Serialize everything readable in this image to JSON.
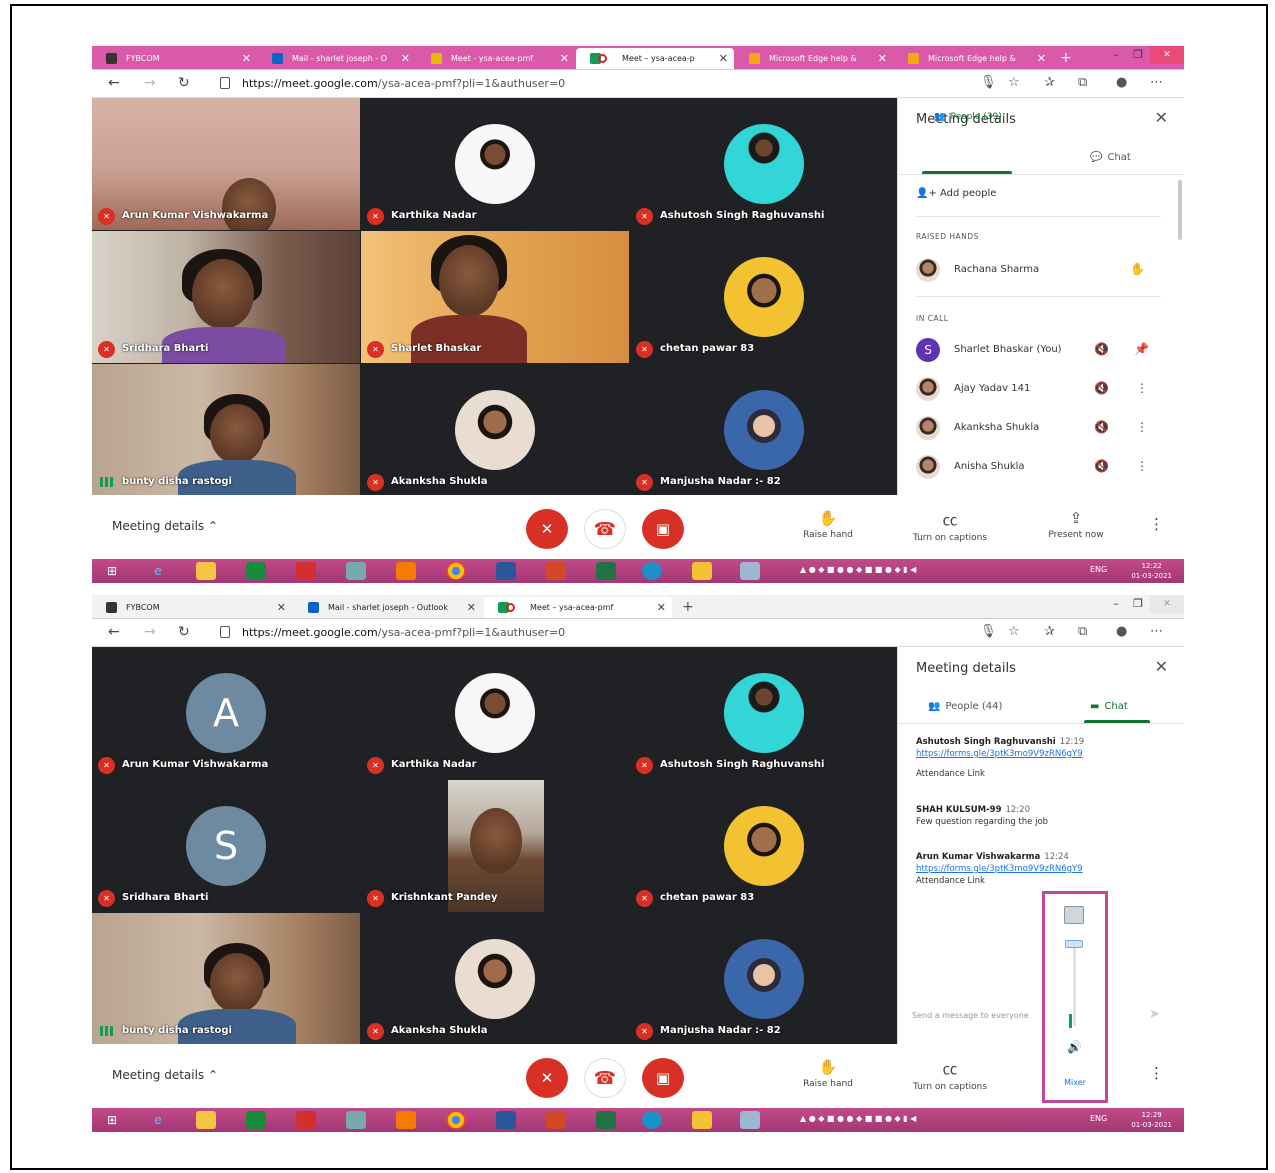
{
  "screens": [
    {
      "tabs": [
        "FYBCOM",
        "Mail - sharlet joseph - O",
        "Meet - ysa-acea-pmf",
        "Meet – ysa-acea-p",
        "Microsoft Edge help & ",
        "Microsoft Edge help & "
      ],
      "url_host": "https://meet.google.com",
      "url_path": "/ysa-acea-pmf?pli=1&authuser=0",
      "tiles": [
        {
          "name": "Arun Kumar Vishwakarma"
        },
        {
          "name": "Karthika Nadar"
        },
        {
          "name": "Ashutosh Singh Raghuvanshi"
        },
        {
          "name": "Sridhara Bharti"
        },
        {
          "name": "Sharlet Bhaskar"
        },
        {
          "name": "chetan pawar 83"
        },
        {
          "name": "bunty disha rastogi"
        },
        {
          "name": "Akanksha Shukla"
        },
        {
          "name": "Manjusha Nadar :- 82"
        }
      ],
      "panel": {
        "title": "Meeting details",
        "tab_people": "People (39)",
        "tab_chat": "Chat",
        "add_people": "Add people",
        "raised_hands": "RAISED HANDS",
        "raised": "Rachana Sharma",
        "in_call": "IN CALL",
        "avatar_letter": "S",
        "people": [
          "Sharlet Bhaskar (You)",
          "Ajay Yadav 141",
          "Akanksha Shukla",
          "Anisha Shukla"
        ]
      },
      "controls": {
        "meeting_details": "Meeting details",
        "raise_hand": "Raise hand",
        "captions": "Turn on captions",
        "present": "Present now"
      },
      "taskbar": {
        "lang": "ENG",
        "time": "12:22",
        "date": "01-03-2021"
      }
    },
    {
      "tabs": [
        "FYBCOM",
        "Mail - sharlet joseph - Outlook",
        "Meet – ysa-acea-pmf"
      ],
      "url_host": "https://meet.google.com",
      "url_path": "/ysa-acea-pmf?pli=1&authuser=0",
      "tiles": [
        {
          "name": "Arun Kumar Vishwakarma",
          "letter": "A"
        },
        {
          "name": "Karthika Nadar"
        },
        {
          "name": "Ashutosh Singh Raghuvanshi"
        },
        {
          "name": "Sridhara Bharti",
          "letter": "S"
        },
        {
          "name": "Krishnkant Pandey"
        },
        {
          "name": "chetan pawar 83"
        },
        {
          "name": "bunty disha rastogi"
        },
        {
          "name": "Akanksha Shukla"
        },
        {
          "name": "Manjusha Nadar :- 82"
        }
      ],
      "panel": {
        "title": "Meeting details",
        "tab_people": "People (44)",
        "tab_chat": "Chat",
        "messages": [
          {
            "author": "Ashutosh Singh Raghuvanshi",
            "time": "12:19",
            "link": "https://forms.gle/3ptK3mo9V9zRN6gY9",
            "text": "Attendance Link"
          },
          {
            "author": "SHAH KULSUM-99",
            "time": "12:20",
            "text": "Few question regarding the job"
          },
          {
            "author": "Arun Kumar Vishwakarma",
            "time": "12:24",
            "link": "https://forms.gle/3ptK3mo9V9zRN6gY9",
            "text": "Attendance Link"
          }
        ],
        "send_placeholder": "Send a message to everyone"
      },
      "controls": {
        "meeting_details": "Meeting details",
        "raise_hand": "Raise hand",
        "captions": "Turn on captions"
      },
      "mixer": {
        "label": "Mixer"
      },
      "taskbar": {
        "lang": "ENG",
        "time": "12:29",
        "date": "01-03-2021"
      }
    }
  ]
}
